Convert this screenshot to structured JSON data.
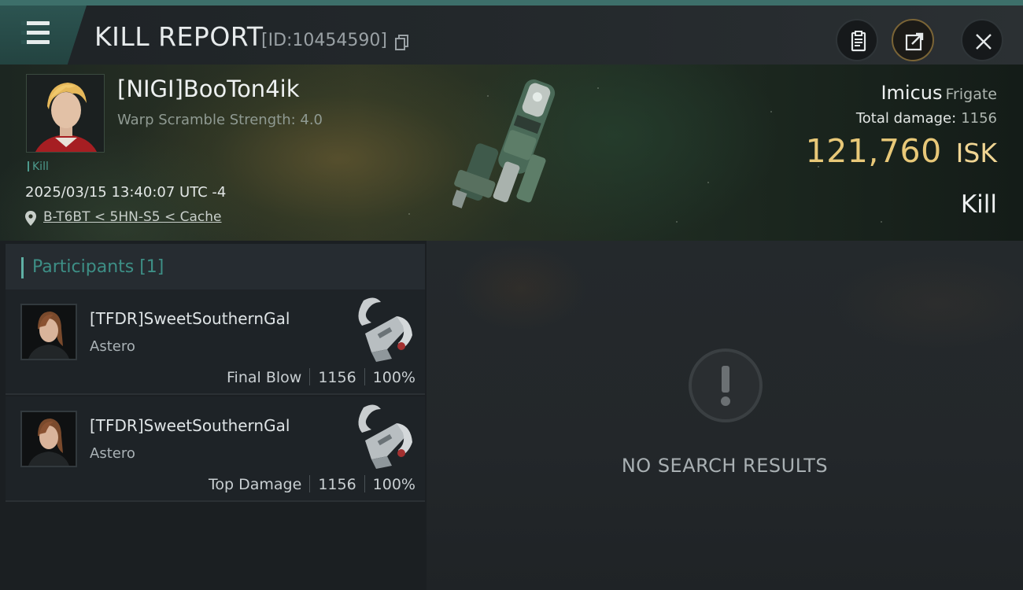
{
  "header": {
    "title": "KILL REPORT",
    "report_id": "[ID:10454590]",
    "icons": [
      "menu-icon",
      "copy-icon",
      "clipboard-icon",
      "share-icon",
      "close-icon"
    ]
  },
  "victim": {
    "name": "[NIGI]BooTon4ik",
    "subtitle": "Warp Scramble Strength: 4.0",
    "tag": "Kill",
    "time": "2025/03/15 13:40:07 UTC -4",
    "location": "B-T6BT < 5HN-S5 < Cache",
    "ship": "Imicus",
    "ship_class": "Frigate",
    "total_damage_label": "Total damage:",
    "total_damage": "1156",
    "isk_value": "121,760",
    "isk_unit": "ISK",
    "kill_type": "Kill"
  },
  "participants": {
    "title": "Participants [1]",
    "rows": [
      {
        "name": "[TFDR]SweetSouthernGal",
        "ship": "Astero",
        "role": "Final Blow",
        "damage": "1156",
        "percent": "100%"
      },
      {
        "name": "[TFDR]SweetSouthernGal",
        "ship": "Astero",
        "role": "Top Damage",
        "damage": "1156",
        "percent": "100%"
      }
    ]
  },
  "results": {
    "empty_text": "NO SEARCH RESULTS",
    "icon": "alert-icon"
  },
  "colors": {
    "accent": "#3d6f6a",
    "isk": "#e8c878",
    "participants_title": "#3d8f86"
  }
}
